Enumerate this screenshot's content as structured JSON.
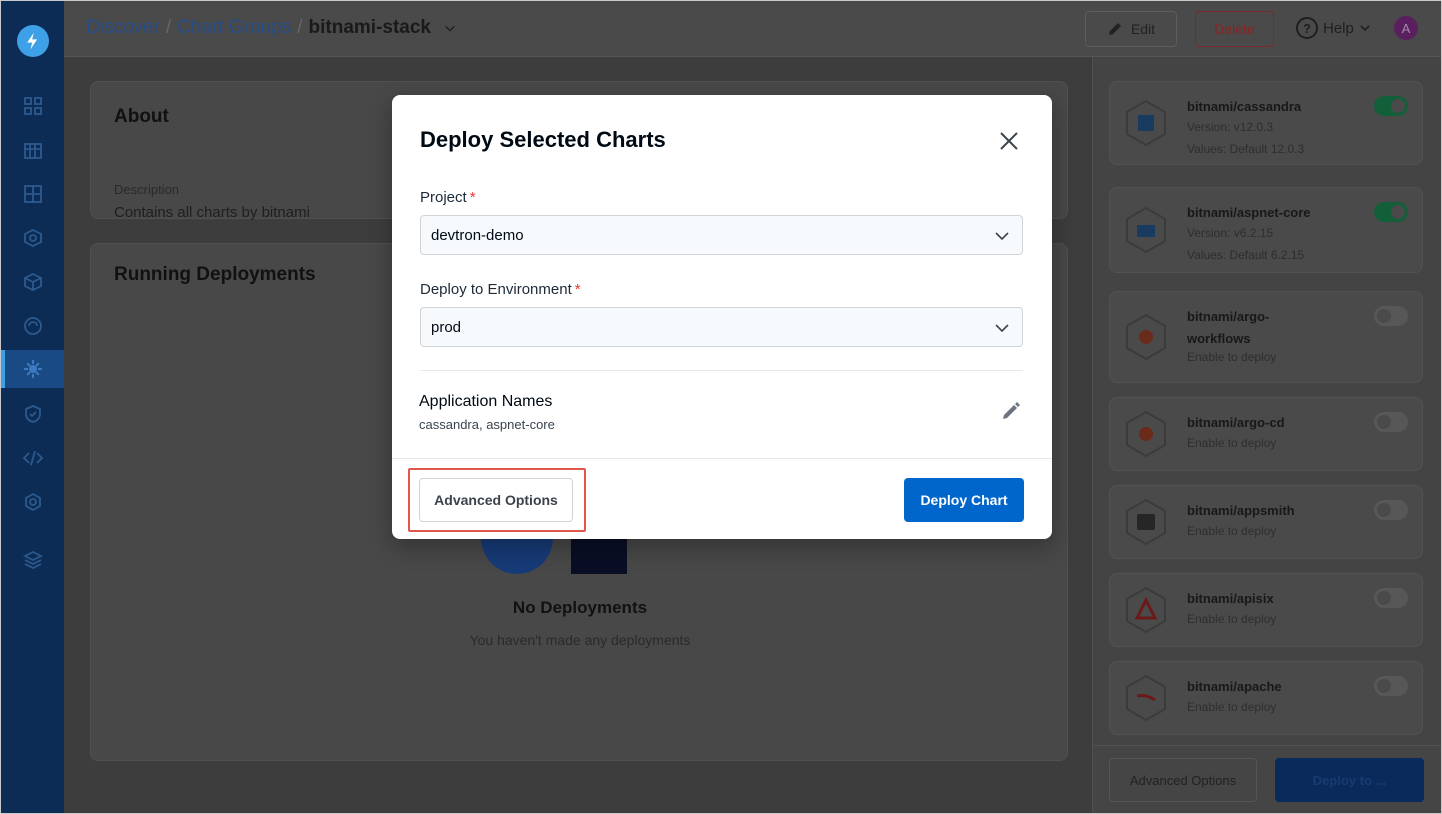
{
  "header": {
    "breadcrumb": {
      "discover": "Discover",
      "sep1": "/",
      "chart_groups": "Chart Groups",
      "sep2": "/",
      "current": "bitnami-stack"
    },
    "edit_label": "Edit",
    "delete_label": "Delete",
    "help_label": "Help",
    "help_icon_glyph": "?",
    "avatar_initial": "A"
  },
  "about": {
    "title": "About",
    "description_label": "Description",
    "description_value": "Contains all charts by bitnami"
  },
  "deployments": {
    "title": "Running Deployments",
    "empty_title": "No Deployments",
    "empty_subtitle": "You haven't made any deployments"
  },
  "charts": [
    {
      "name": "bitnami/cassandra",
      "version": "Version: v12.0.3",
      "values": "Values: Default 12.0.3",
      "enabled": true,
      "icon": "cassandra-icon"
    },
    {
      "name": "bitnami/aspnet-core",
      "version": "Version: v6.2.15",
      "values": "Values: Default 6.2.15",
      "enabled": true,
      "icon": "briefcase-icon"
    },
    {
      "name": "bitnami/argo-workflows",
      "hint": "Enable to deploy",
      "enabled": false,
      "icon": "argo-icon"
    },
    {
      "name": "bitnami/argo-cd",
      "hint": "Enable to deploy",
      "enabled": false,
      "icon": "argo-icon"
    },
    {
      "name": "bitnami/appsmith",
      "hint": "Enable to deploy",
      "enabled": false,
      "icon": "appsmith-icon"
    },
    {
      "name": "bitnami/apisix",
      "hint": "Enable to deploy",
      "enabled": false,
      "icon": "apisix-icon"
    },
    {
      "name": "bitnami/apache",
      "hint": "Enable to deploy",
      "enabled": false,
      "icon": "apache-icon"
    }
  ],
  "right_footer": {
    "advanced_label": "Advanced Options",
    "deploy_label": "Deploy to ..."
  },
  "modal": {
    "title": "Deploy Selected Charts",
    "project_label": "Project",
    "project_value": "devtron-demo",
    "env_label": "Deploy to Environment",
    "env_value": "prod",
    "required_mark": "*",
    "app_names_label": "Application Names",
    "app_names_value": "cassandra, aspnet-core",
    "advanced_label": "Advanced Options",
    "deploy_label": "Deploy Chart"
  },
  "colors": {
    "primary": "#0066cc",
    "highlight": "#e2574c",
    "required": "#e53935",
    "sidebar": "#0c2c56"
  }
}
